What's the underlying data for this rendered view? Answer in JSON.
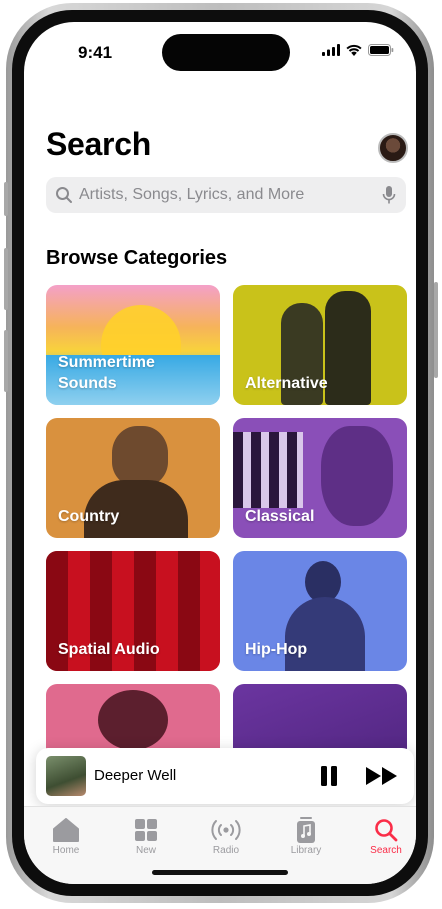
{
  "status": {
    "time": "9:41"
  },
  "header": {
    "title": "Search"
  },
  "search": {
    "placeholder": "Artists, Songs, Lyrics, and More"
  },
  "browse": {
    "title": "Browse Categories",
    "tiles": [
      {
        "label": "Summertime Sounds",
        "color": "#f5b23a"
      },
      {
        "label": "Alternative",
        "color": "#c9c21a"
      },
      {
        "label": "Country",
        "color": "#d9913e"
      },
      {
        "label": "Classical",
        "color": "#8a4fb8"
      },
      {
        "label": "Spatial Audio",
        "color": "#c8101f"
      },
      {
        "label": "Hip-Hop",
        "color": "#6a86e6"
      },
      {
        "label": "",
        "color": "#e06a8e"
      },
      {
        "label": "",
        "color": "#5c2c8f"
      }
    ]
  },
  "now_playing": {
    "title": "Deeper Well"
  },
  "tabbar": {
    "items": [
      {
        "label": "Home",
        "icon": "house-icon"
      },
      {
        "label": "New",
        "icon": "grid-icon"
      },
      {
        "label": "Radio",
        "icon": "radio-waves-icon"
      },
      {
        "label": "Library",
        "icon": "music-note-icon"
      },
      {
        "label": "Search",
        "icon": "search-icon"
      }
    ],
    "active": "Search",
    "accent": "#fa2d48"
  }
}
